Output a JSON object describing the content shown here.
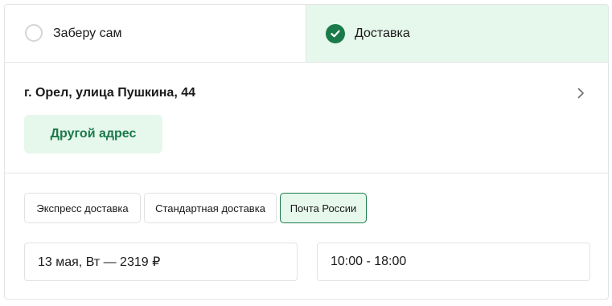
{
  "delivery_toggle": {
    "pickup_label": "Заберу сам",
    "delivery_label": "Доставка",
    "selected": "delivery"
  },
  "address": {
    "text": "г. Орел, улица Пушкина, 44",
    "other_button": "Другой адрес"
  },
  "methods": [
    {
      "label": "Экспресс доставка",
      "selected": false
    },
    {
      "label": "Стандартная доставка",
      "selected": false
    },
    {
      "label": "Почта России",
      "selected": true
    }
  ],
  "date_field": "13 мая, Вт — 2319 ₽",
  "time_field": "10:00 - 18:00",
  "colors": {
    "accent": "#1b7a4a",
    "accent_light": "#e6f7ec",
    "border": "#e3e5e5"
  },
  "icons": {
    "checked": "check-icon",
    "chevron": "chevron-right-icon"
  }
}
